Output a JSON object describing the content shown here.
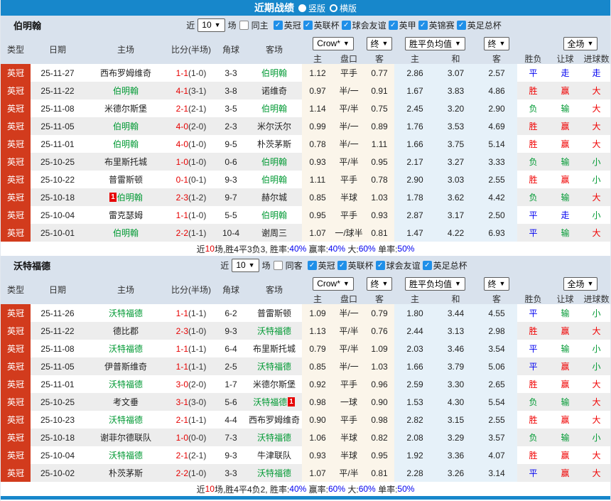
{
  "title_bar": {
    "title": "近期战绩",
    "radios": [
      {
        "label": "竖版",
        "selected": true
      },
      {
        "label": "横版",
        "selected": false
      }
    ]
  },
  "colors": {
    "accent_blue": "#1787cb",
    "league_badge_red": "#d23b1d",
    "team_green": "#009933",
    "score_red": "#e60000",
    "result_red": "#f00000",
    "result_green": "#009933",
    "result_blue": "#0000f0",
    "odds_cream_bg": "#fbf5ea",
    "europe_blue_bg": "#e6f1f9",
    "head_bg": "#d9e2ed",
    "stripe_gray": "#ededed",
    "checkbox_blue": "#1f8fe8"
  },
  "table_header": {
    "cols_left": [
      "类型",
      "日期",
      "主场",
      "比分(半场)",
      "角球",
      "客场"
    ],
    "cols_sub": [
      "主",
      "盘口",
      "客",
      "主",
      "和",
      "客",
      "胜负",
      "让球",
      "进球数"
    ],
    "dropdowns": {
      "odds_company": "Crow*",
      "odds_state": "终",
      "europe": "胜平负均值",
      "europe_state": "终",
      "scope": "全场"
    }
  },
  "sections": [
    {
      "team": "伯明翰",
      "filter": {
        "near": "近",
        "count": "10",
        "games": "场",
        "same": {
          "label": "同主",
          "checked": false
        },
        "leagues": [
          {
            "label": "英冠",
            "checked": true
          },
          {
            "label": "英联杯",
            "checked": true
          },
          {
            "label": "球会友谊",
            "checked": true
          },
          {
            "label": "英甲",
            "checked": true
          },
          {
            "label": "英锦赛",
            "checked": true
          },
          {
            "label": "英足总杯",
            "checked": true
          }
        ]
      },
      "rows": [
        {
          "league": "英冠",
          "date": "25-11-27",
          "home": {
            "name": "西布罗姆维奇",
            "green": false
          },
          "score": "1-1",
          "half": "(1-0)",
          "corner": "3-3",
          "away": {
            "name": "伯明翰",
            "green": true
          },
          "crow": [
            "1.12",
            "平手",
            "0.77"
          ],
          "europe": [
            "2.86",
            "3.07",
            "2.57"
          ],
          "results": [
            {
              "t": "平",
              "c": "b"
            },
            {
              "t": "走",
              "c": "b"
            },
            {
              "t": "走",
              "c": "b"
            }
          ]
        },
        {
          "league": "英冠",
          "date": "25-11-22",
          "home": {
            "name": "伯明翰",
            "green": true
          },
          "score": "4-1",
          "half": "(3-1)",
          "corner": "3-8",
          "away": {
            "name": "诺维奇",
            "green": false
          },
          "crow": [
            "0.97",
            "半/一",
            "0.91"
          ],
          "europe": [
            "1.67",
            "3.83",
            "4.86"
          ],
          "results": [
            {
              "t": "胜",
              "c": "r"
            },
            {
              "t": "赢",
              "c": "r"
            },
            {
              "t": "大",
              "c": "r"
            }
          ]
        },
        {
          "league": "英冠",
          "date": "25-11-08",
          "home": {
            "name": "米德尔斯堡",
            "green": false
          },
          "score": "2-1",
          "half": "(2-1)",
          "corner": "3-5",
          "away": {
            "name": "伯明翰",
            "green": true
          },
          "crow": [
            "1.14",
            "平/半",
            "0.75"
          ],
          "europe": [
            "2.45",
            "3.20",
            "2.90"
          ],
          "results": [
            {
              "t": "负",
              "c": "g"
            },
            {
              "t": "输",
              "c": "g"
            },
            {
              "t": "大",
              "c": "r"
            }
          ]
        },
        {
          "league": "英冠",
          "date": "25-11-05",
          "home": {
            "name": "伯明翰",
            "green": true
          },
          "score": "4-0",
          "half": "(2-0)",
          "corner": "2-3",
          "away": {
            "name": "米尔沃尔",
            "green": false
          },
          "crow": [
            "0.99",
            "半/一",
            "0.89"
          ],
          "europe": [
            "1.76",
            "3.53",
            "4.69"
          ],
          "results": [
            {
              "t": "胜",
              "c": "r"
            },
            {
              "t": "赢",
              "c": "r"
            },
            {
              "t": "大",
              "c": "r"
            }
          ]
        },
        {
          "league": "英冠",
          "date": "25-11-01",
          "home": {
            "name": "伯明翰",
            "green": true
          },
          "score": "4-0",
          "half": "(1-0)",
          "corner": "9-5",
          "away": {
            "name": "朴茨茅斯",
            "green": false
          },
          "crow": [
            "0.78",
            "半/一",
            "1.11"
          ],
          "europe": [
            "1.66",
            "3.75",
            "5.14"
          ],
          "results": [
            {
              "t": "胜",
              "c": "r"
            },
            {
              "t": "赢",
              "c": "r"
            },
            {
              "t": "大",
              "c": "r"
            }
          ]
        },
        {
          "league": "英冠",
          "date": "25-10-25",
          "home": {
            "name": "布里斯托城",
            "green": false
          },
          "score": "1-0",
          "half": "(1-0)",
          "corner": "0-6",
          "away": {
            "name": "伯明翰",
            "green": true
          },
          "crow": [
            "0.93",
            "平/半",
            "0.95"
          ],
          "europe": [
            "2.17",
            "3.27",
            "3.33"
          ],
          "results": [
            {
              "t": "负",
              "c": "g"
            },
            {
              "t": "输",
              "c": "g"
            },
            {
              "t": "小",
              "c": "g"
            }
          ]
        },
        {
          "league": "英冠",
          "date": "25-10-22",
          "home": {
            "name": "普雷斯顿",
            "green": false
          },
          "score": "0-1",
          "half": "(0-1)",
          "corner": "9-3",
          "away": {
            "name": "伯明翰",
            "green": true
          },
          "crow": [
            "1.11",
            "平手",
            "0.78"
          ],
          "europe": [
            "2.90",
            "3.03",
            "2.55"
          ],
          "results": [
            {
              "t": "胜",
              "c": "r"
            },
            {
              "t": "赢",
              "c": "r"
            },
            {
              "t": "小",
              "c": "g"
            }
          ]
        },
        {
          "league": "英冠",
          "date": "25-10-18",
          "home": {
            "name": "伯明翰",
            "green": true,
            "badge": "1",
            "badge_pos": "pre"
          },
          "score": "2-3",
          "half": "(1-2)",
          "corner": "9-7",
          "away": {
            "name": "赫尔城",
            "green": false
          },
          "crow": [
            "0.85",
            "半球",
            "1.03"
          ],
          "europe": [
            "1.78",
            "3.62",
            "4.42"
          ],
          "results": [
            {
              "t": "负",
              "c": "g"
            },
            {
              "t": "输",
              "c": "g"
            },
            {
              "t": "大",
              "c": "r"
            }
          ]
        },
        {
          "league": "英冠",
          "date": "25-10-04",
          "home": {
            "name": "雷克瑟姆",
            "green": false
          },
          "score": "1-1",
          "half": "(1-0)",
          "corner": "5-5",
          "away": {
            "name": "伯明翰",
            "green": true
          },
          "crow": [
            "0.95",
            "平手",
            "0.93"
          ],
          "europe": [
            "2.87",
            "3.17",
            "2.50"
          ],
          "results": [
            {
              "t": "平",
              "c": "b"
            },
            {
              "t": "走",
              "c": "b"
            },
            {
              "t": "小",
              "c": "g"
            }
          ]
        },
        {
          "league": "英冠",
          "date": "25-10-01",
          "home": {
            "name": "伯明翰",
            "green": true
          },
          "score": "2-2",
          "half": "(1-1)",
          "corner": "10-4",
          "away": {
            "name": "谢周三",
            "green": false
          },
          "crow": [
            "1.07",
            "一/球半",
            "0.81"
          ],
          "europe": [
            "1.47",
            "4.22",
            "6.93"
          ],
          "results": [
            {
              "t": "平",
              "c": "b"
            },
            {
              "t": "输",
              "c": "g"
            },
            {
              "t": "大",
              "c": "r"
            }
          ]
        }
      ],
      "summary": [
        {
          "t": "近",
          "c": "k"
        },
        {
          "t": "10",
          "c": "r"
        },
        {
          "t": "场,胜4平3负3, 胜率:",
          "c": "k"
        },
        {
          "t": "40%",
          "c": "b"
        },
        {
          "t": " 赢率:",
          "c": "k"
        },
        {
          "t": "40%",
          "c": "b"
        },
        {
          "t": " 大:",
          "c": "k"
        },
        {
          "t": "60%",
          "c": "b"
        },
        {
          "t": " 单率:",
          "c": "k"
        },
        {
          "t": "50%",
          "c": "b"
        }
      ]
    },
    {
      "team": "沃特福德",
      "filter": {
        "near": "近",
        "count": "10",
        "games": "场",
        "same": {
          "label": "同客",
          "checked": false
        },
        "leagues": [
          {
            "label": "英冠",
            "checked": true
          },
          {
            "label": "英联杯",
            "checked": true
          },
          {
            "label": "球会友谊",
            "checked": true
          },
          {
            "label": "英足总杯",
            "checked": true
          }
        ]
      },
      "rows": [
        {
          "league": "英冠",
          "date": "25-11-26",
          "home": {
            "name": "沃特福德",
            "green": true
          },
          "score": "1-1",
          "half": "(1-1)",
          "corner": "6-2",
          "away": {
            "name": "普雷斯顿",
            "green": false
          },
          "crow": [
            "1.09",
            "半/一",
            "0.79"
          ],
          "europe": [
            "1.80",
            "3.44",
            "4.55"
          ],
          "results": [
            {
              "t": "平",
              "c": "b"
            },
            {
              "t": "输",
              "c": "g"
            },
            {
              "t": "小",
              "c": "g"
            }
          ]
        },
        {
          "league": "英冠",
          "date": "25-11-22",
          "home": {
            "name": "德比郡",
            "green": false
          },
          "score": "2-3",
          "half": "(1-0)",
          "corner": "9-3",
          "away": {
            "name": "沃特福德",
            "green": true
          },
          "crow": [
            "1.13",
            "平/半",
            "0.76"
          ],
          "europe": [
            "2.44",
            "3.13",
            "2.98"
          ],
          "results": [
            {
              "t": "胜",
              "c": "r"
            },
            {
              "t": "赢",
              "c": "r"
            },
            {
              "t": "大",
              "c": "r"
            }
          ]
        },
        {
          "league": "英冠",
          "date": "25-11-08",
          "home": {
            "name": "沃特福德",
            "green": true
          },
          "score": "1-1",
          "half": "(1-1)",
          "corner": "6-4",
          "away": {
            "name": "布里斯托城",
            "green": false
          },
          "crow": [
            "0.79",
            "平/半",
            "1.09"
          ],
          "europe": [
            "2.03",
            "3.46",
            "3.54"
          ],
          "results": [
            {
              "t": "平",
              "c": "b"
            },
            {
              "t": "输",
              "c": "g"
            },
            {
              "t": "小",
              "c": "g"
            }
          ]
        },
        {
          "league": "英冠",
          "date": "25-11-05",
          "home": {
            "name": "伊普斯维奇",
            "green": false
          },
          "score": "1-1",
          "half": "(1-1)",
          "corner": "2-5",
          "away": {
            "name": "沃特福德",
            "green": true
          },
          "crow": [
            "0.85",
            "半/一",
            "1.03"
          ],
          "europe": [
            "1.66",
            "3.79",
            "5.06"
          ],
          "results": [
            {
              "t": "平",
              "c": "b"
            },
            {
              "t": "赢",
              "c": "r"
            },
            {
              "t": "小",
              "c": "g"
            }
          ]
        },
        {
          "league": "英冠",
          "date": "25-11-01",
          "home": {
            "name": "沃特福德",
            "green": true
          },
          "score": "3-0",
          "half": "(2-0)",
          "corner": "1-7",
          "away": {
            "name": "米德尔斯堡",
            "green": false
          },
          "crow": [
            "0.92",
            "平手",
            "0.96"
          ],
          "europe": [
            "2.59",
            "3.30",
            "2.65"
          ],
          "results": [
            {
              "t": "胜",
              "c": "r"
            },
            {
              "t": "赢",
              "c": "r"
            },
            {
              "t": "大",
              "c": "r"
            }
          ]
        },
        {
          "league": "英冠",
          "date": "25-10-25",
          "home": {
            "name": "考文垂",
            "green": false
          },
          "score": "3-1",
          "half": "(3-0)",
          "corner": "5-6",
          "away": {
            "name": "沃特福德",
            "green": true,
            "badge": "1",
            "badge_pos": "post"
          },
          "crow": [
            "0.98",
            "一球",
            "0.90"
          ],
          "europe": [
            "1.53",
            "4.30",
            "5.54"
          ],
          "results": [
            {
              "t": "负",
              "c": "g"
            },
            {
              "t": "输",
              "c": "g"
            },
            {
              "t": "大",
              "c": "r"
            }
          ]
        },
        {
          "league": "英冠",
          "date": "25-10-23",
          "home": {
            "name": "沃特福德",
            "green": true
          },
          "score": "2-1",
          "half": "(1-1)",
          "corner": "4-4",
          "away": {
            "name": "西布罗姆维奇",
            "green": false
          },
          "crow": [
            "0.90",
            "平手",
            "0.98"
          ],
          "europe": [
            "2.82",
            "3.15",
            "2.55"
          ],
          "results": [
            {
              "t": "胜",
              "c": "r"
            },
            {
              "t": "赢",
              "c": "r"
            },
            {
              "t": "大",
              "c": "r"
            }
          ]
        },
        {
          "league": "英冠",
          "date": "25-10-18",
          "home": {
            "name": "谢菲尔德联队",
            "green": false
          },
          "score": "1-0",
          "half": "(0-0)",
          "corner": "7-3",
          "away": {
            "name": "沃特福德",
            "green": true
          },
          "crow": [
            "1.06",
            "半球",
            "0.82"
          ],
          "europe": [
            "2.08",
            "3.29",
            "3.57"
          ],
          "results": [
            {
              "t": "负",
              "c": "g"
            },
            {
              "t": "输",
              "c": "g"
            },
            {
              "t": "小",
              "c": "g"
            }
          ]
        },
        {
          "league": "英冠",
          "date": "25-10-04",
          "home": {
            "name": "沃特福德",
            "green": true
          },
          "score": "2-1",
          "half": "(2-1)",
          "corner": "9-3",
          "away": {
            "name": "牛津联队",
            "green": false
          },
          "crow": [
            "0.93",
            "半球",
            "0.95"
          ],
          "europe": [
            "1.92",
            "3.36",
            "4.07"
          ],
          "results": [
            {
              "t": "胜",
              "c": "r"
            },
            {
              "t": "赢",
              "c": "r"
            },
            {
              "t": "大",
              "c": "r"
            }
          ]
        },
        {
          "league": "英冠",
          "date": "25-10-02",
          "home": {
            "name": "朴茨茅斯",
            "green": false
          },
          "score": "2-2",
          "half": "(1-0)",
          "corner": "3-3",
          "away": {
            "name": "沃特福德",
            "green": true
          },
          "crow": [
            "1.07",
            "平/半",
            "0.81"
          ],
          "europe": [
            "2.28",
            "3.26",
            "3.14"
          ],
          "results": [
            {
              "t": "平",
              "c": "b"
            },
            {
              "t": "赢",
              "c": "r"
            },
            {
              "t": "大",
              "c": "r"
            }
          ]
        }
      ],
      "summary": [
        {
          "t": "近",
          "c": "k"
        },
        {
          "t": "10",
          "c": "r"
        },
        {
          "t": "场,胜4平4负2, 胜率:",
          "c": "k"
        },
        {
          "t": "40%",
          "c": "b"
        },
        {
          "t": " 赢率:",
          "c": "k"
        },
        {
          "t": "60%",
          "c": "b"
        },
        {
          "t": " 大:",
          "c": "k"
        },
        {
          "t": "60%",
          "c": "b"
        },
        {
          "t": " 单率:",
          "c": "k"
        },
        {
          "t": "50%",
          "c": "b"
        }
      ]
    }
  ]
}
